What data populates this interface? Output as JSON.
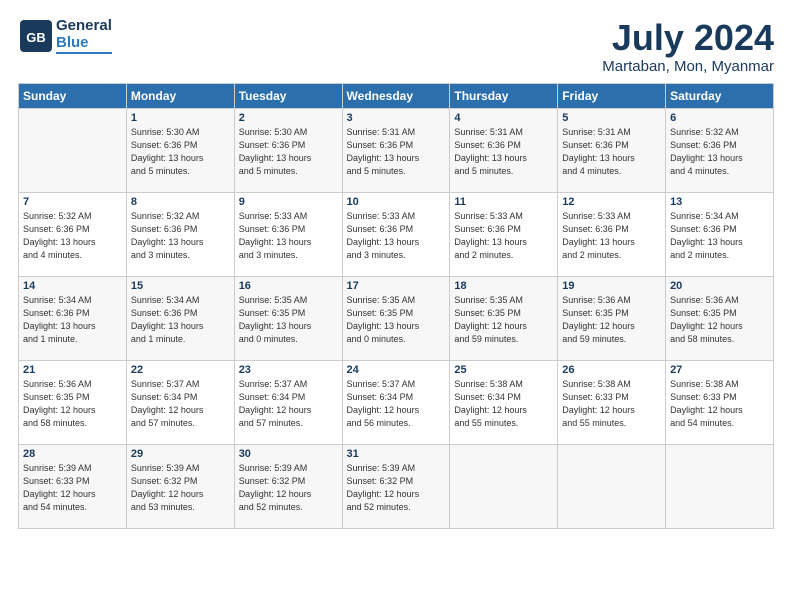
{
  "header": {
    "logo_general": "General",
    "logo_blue": "Blue",
    "month_title": "July 2024",
    "location": "Martaban, Mon, Myanmar"
  },
  "days_of_week": [
    "Sunday",
    "Monday",
    "Tuesday",
    "Wednesday",
    "Thursday",
    "Friday",
    "Saturday"
  ],
  "weeks": [
    [
      {
        "num": "",
        "info": ""
      },
      {
        "num": "1",
        "info": "Sunrise: 5:30 AM\nSunset: 6:36 PM\nDaylight: 13 hours\nand 5 minutes."
      },
      {
        "num": "2",
        "info": "Sunrise: 5:30 AM\nSunset: 6:36 PM\nDaylight: 13 hours\nand 5 minutes."
      },
      {
        "num": "3",
        "info": "Sunrise: 5:31 AM\nSunset: 6:36 PM\nDaylight: 13 hours\nand 5 minutes."
      },
      {
        "num": "4",
        "info": "Sunrise: 5:31 AM\nSunset: 6:36 PM\nDaylight: 13 hours\nand 5 minutes."
      },
      {
        "num": "5",
        "info": "Sunrise: 5:31 AM\nSunset: 6:36 PM\nDaylight: 13 hours\nand 4 minutes."
      },
      {
        "num": "6",
        "info": "Sunrise: 5:32 AM\nSunset: 6:36 PM\nDaylight: 13 hours\nand 4 minutes."
      }
    ],
    [
      {
        "num": "7",
        "info": "Sunrise: 5:32 AM\nSunset: 6:36 PM\nDaylight: 13 hours\nand 4 minutes."
      },
      {
        "num": "8",
        "info": "Sunrise: 5:32 AM\nSunset: 6:36 PM\nDaylight: 13 hours\nand 3 minutes."
      },
      {
        "num": "9",
        "info": "Sunrise: 5:33 AM\nSunset: 6:36 PM\nDaylight: 13 hours\nand 3 minutes."
      },
      {
        "num": "10",
        "info": "Sunrise: 5:33 AM\nSunset: 6:36 PM\nDaylight: 13 hours\nand 3 minutes."
      },
      {
        "num": "11",
        "info": "Sunrise: 5:33 AM\nSunset: 6:36 PM\nDaylight: 13 hours\nand 2 minutes."
      },
      {
        "num": "12",
        "info": "Sunrise: 5:33 AM\nSunset: 6:36 PM\nDaylight: 13 hours\nand 2 minutes."
      },
      {
        "num": "13",
        "info": "Sunrise: 5:34 AM\nSunset: 6:36 PM\nDaylight: 13 hours\nand 2 minutes."
      }
    ],
    [
      {
        "num": "14",
        "info": "Sunrise: 5:34 AM\nSunset: 6:36 PM\nDaylight: 13 hours\nand 1 minute."
      },
      {
        "num": "15",
        "info": "Sunrise: 5:34 AM\nSunset: 6:36 PM\nDaylight: 13 hours\nand 1 minute."
      },
      {
        "num": "16",
        "info": "Sunrise: 5:35 AM\nSunset: 6:35 PM\nDaylight: 13 hours\nand 0 minutes."
      },
      {
        "num": "17",
        "info": "Sunrise: 5:35 AM\nSunset: 6:35 PM\nDaylight: 13 hours\nand 0 minutes."
      },
      {
        "num": "18",
        "info": "Sunrise: 5:35 AM\nSunset: 6:35 PM\nDaylight: 12 hours\nand 59 minutes."
      },
      {
        "num": "19",
        "info": "Sunrise: 5:36 AM\nSunset: 6:35 PM\nDaylight: 12 hours\nand 59 minutes."
      },
      {
        "num": "20",
        "info": "Sunrise: 5:36 AM\nSunset: 6:35 PM\nDaylight: 12 hours\nand 58 minutes."
      }
    ],
    [
      {
        "num": "21",
        "info": "Sunrise: 5:36 AM\nSunset: 6:35 PM\nDaylight: 12 hours\nand 58 minutes."
      },
      {
        "num": "22",
        "info": "Sunrise: 5:37 AM\nSunset: 6:34 PM\nDaylight: 12 hours\nand 57 minutes."
      },
      {
        "num": "23",
        "info": "Sunrise: 5:37 AM\nSunset: 6:34 PM\nDaylight: 12 hours\nand 57 minutes."
      },
      {
        "num": "24",
        "info": "Sunrise: 5:37 AM\nSunset: 6:34 PM\nDaylight: 12 hours\nand 56 minutes."
      },
      {
        "num": "25",
        "info": "Sunrise: 5:38 AM\nSunset: 6:34 PM\nDaylight: 12 hours\nand 55 minutes."
      },
      {
        "num": "26",
        "info": "Sunrise: 5:38 AM\nSunset: 6:33 PM\nDaylight: 12 hours\nand 55 minutes."
      },
      {
        "num": "27",
        "info": "Sunrise: 5:38 AM\nSunset: 6:33 PM\nDaylight: 12 hours\nand 54 minutes."
      }
    ],
    [
      {
        "num": "28",
        "info": "Sunrise: 5:39 AM\nSunset: 6:33 PM\nDaylight: 12 hours\nand 54 minutes."
      },
      {
        "num": "29",
        "info": "Sunrise: 5:39 AM\nSunset: 6:32 PM\nDaylight: 12 hours\nand 53 minutes."
      },
      {
        "num": "30",
        "info": "Sunrise: 5:39 AM\nSunset: 6:32 PM\nDaylight: 12 hours\nand 52 minutes."
      },
      {
        "num": "31",
        "info": "Sunrise: 5:39 AM\nSunset: 6:32 PM\nDaylight: 12 hours\nand 52 minutes."
      },
      {
        "num": "",
        "info": ""
      },
      {
        "num": "",
        "info": ""
      },
      {
        "num": "",
        "info": ""
      }
    ]
  ]
}
